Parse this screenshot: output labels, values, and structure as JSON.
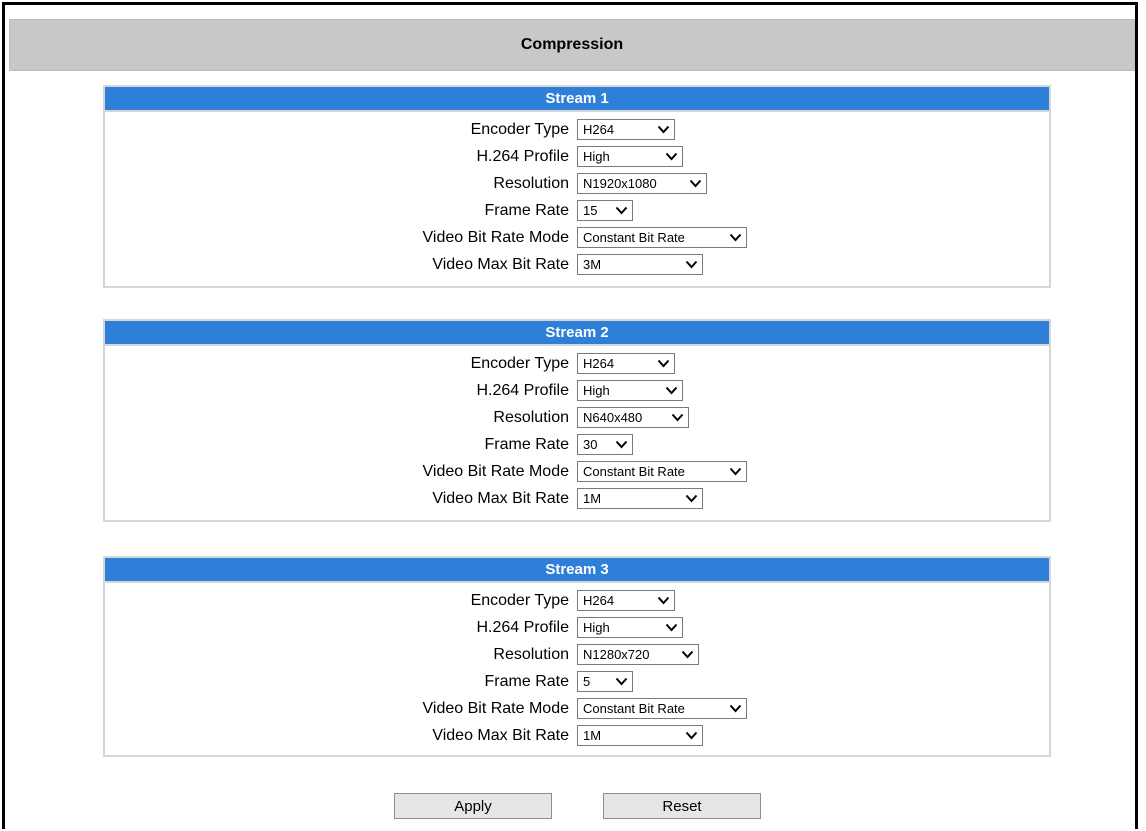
{
  "header": {
    "title": "Compression"
  },
  "streams": [
    {
      "title": "Stream 1",
      "fields": [
        {
          "label": "Encoder Type",
          "value": "H264"
        },
        {
          "label": "H.264 Profile",
          "value": "High"
        },
        {
          "label": "Resolution",
          "value": "N1920x1080"
        },
        {
          "label": "Frame Rate",
          "value": "15"
        },
        {
          "label": "Video Bit Rate Mode",
          "value": "Constant Bit Rate"
        },
        {
          "label": "Video Max Bit Rate",
          "value": "3M"
        }
      ]
    },
    {
      "title": "Stream 2",
      "fields": [
        {
          "label": "Encoder Type",
          "value": "H264"
        },
        {
          "label": "H.264 Profile",
          "value": "High"
        },
        {
          "label": "Resolution",
          "value": "N640x480"
        },
        {
          "label": "Frame Rate",
          "value": "30"
        },
        {
          "label": "Video Bit Rate Mode",
          "value": "Constant Bit Rate"
        },
        {
          "label": "Video Max Bit Rate",
          "value": "1M"
        }
      ]
    },
    {
      "title": "Stream 3",
      "fields": [
        {
          "label": "Encoder Type",
          "value": "H264"
        },
        {
          "label": "H.264 Profile",
          "value": "High"
        },
        {
          "label": "Resolution",
          "value": "N1280x720"
        },
        {
          "label": "Frame Rate",
          "value": "5"
        },
        {
          "label": "Video Bit Rate Mode",
          "value": "Constant Bit Rate"
        },
        {
          "label": "Video Max Bit Rate",
          "value": "1M"
        }
      ]
    }
  ],
  "buttons": {
    "apply": "Apply",
    "reset": "Reset"
  },
  "colors": {
    "stream_header": "#2e7fd8",
    "page_header": "#c8c8c8"
  },
  "icons": {
    "dropdown": "chevron-down-icon"
  }
}
